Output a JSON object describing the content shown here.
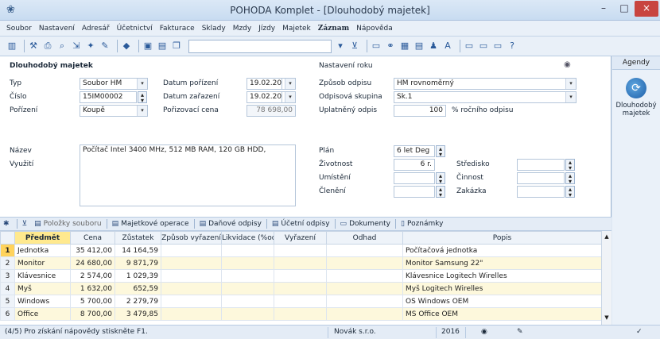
{
  "window": {
    "title": "POHODA Komplet - [Dlouhodobý majetek]",
    "min": "–",
    "max": "□",
    "close": "×"
  },
  "menu": [
    "Soubor",
    "Nastavení",
    "Adresář",
    "Účetnictví",
    "Fakturace",
    "Sklady",
    "Mzdy",
    "Jízdy",
    "Majetek",
    "Záznam",
    "Nápověda"
  ],
  "form": {
    "section_title": "Dlouhodobý majetek",
    "typ_label": "Typ",
    "typ_value": "Soubor HM",
    "cislo_label": "Číslo",
    "cislo_value": "15IM00002",
    "porizeni_label": "Pořízení",
    "porizeni_value": "Koupě",
    "datum_porizeni_label": "Datum pořízení",
    "datum_porizeni_value": "19.02.2015",
    "datum_zarazeni_label": "Datum zařazení",
    "datum_zarazeni_value": "19.02.2015",
    "porizovaci_cena_label": "Pořizovací cena",
    "porizovaci_cena_value": "78 698,00",
    "nazev_label": "Název",
    "nazev_value": "Počítač Intel 3400 MHz, 512 MB RAM, 120 GB HDD,",
    "vyuziti_label": "Využití"
  },
  "settings": {
    "title": "Nastavení roku",
    "zpusob_label": "Způsob odpisu",
    "zpusob_value": "HM rovnoměrný",
    "skupina_label": "Odpisová skupina",
    "skupina_value": "Sk.1",
    "uplatneny_label": "Uplatněný odpis",
    "uplatneny_value": "100",
    "uplatneny_unit": "% ročního odpisu",
    "plan_label": "Plán",
    "plan_value": "6 let Deg",
    "zivotnost_label": "Životnost",
    "zivotnost_value": "6 r.",
    "umisteni_label": "Umístění",
    "cleneni_label": "Členění",
    "stredisko_label": "Středisko",
    "cinnost_label": "Činnost",
    "zakazka_label": "Zakázka"
  },
  "tabs": [
    "Položky souboru",
    "Majetkové operace",
    "Daňové odpisy",
    "Účetní odpisy",
    "Dokumenty",
    "Poznámky"
  ],
  "table": {
    "columns": [
      "Předmět",
      "Cena",
      "Zůstatek",
      "Způsob vyřazení",
      "Likvidace (%od",
      "Vyřazení",
      "Odhad",
      "Popis"
    ],
    "rows": [
      {
        "n": "1",
        "predmet": "Jednotka",
        "cena": "35 412,00",
        "zustatek": "14 164,59",
        "popis": "Počítačová jednotka"
      },
      {
        "n": "2",
        "predmet": "Monitor",
        "cena": "24 680,00",
        "zustatek": "9 871,79",
        "popis": "Monitor Samsung 22\""
      },
      {
        "n": "3",
        "predmet": "Klávesnice",
        "cena": "2 574,00",
        "zustatek": "1 029,39",
        "popis": "Klávesnice Logitech Wirelles"
      },
      {
        "n": "4",
        "predmet": "Myš",
        "cena": "1 632,00",
        "zustatek": "652,59",
        "popis": "Myš Logitech Wirelles"
      },
      {
        "n": "5",
        "predmet": "Windows",
        "cena": "5 700,00",
        "zustatek": "2 279,79",
        "popis": "OS Windows OEM"
      },
      {
        "n": "6",
        "predmet": "Office",
        "cena": "8 700,00",
        "zustatek": "3 479,85",
        "popis": "MS Office OEM"
      }
    ]
  },
  "agenda": {
    "head": "Agendy",
    "label": "Dlouhodobý majetek"
  },
  "status": {
    "help": "(4/5) Pro získání nápovědy stiskněte F1.",
    "company": "Novák s.r.o.",
    "year": "2016"
  },
  "colors": {
    "accent": "#ffd35c",
    "close": "#c8443f"
  }
}
